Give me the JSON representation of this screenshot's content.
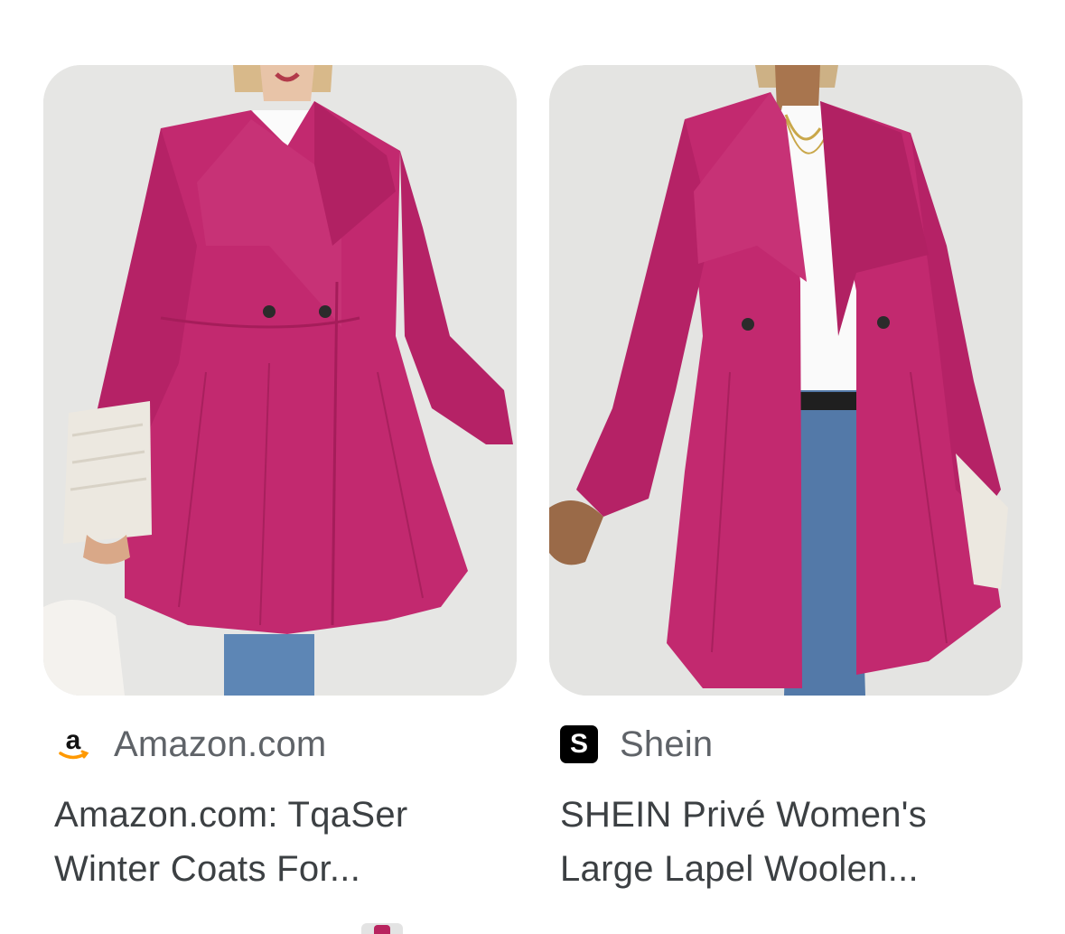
{
  "results": [
    {
      "source": "Amazon.com",
      "source_icon": "amazon-logo-icon",
      "title_line1": "Amazon.com: TqaSer",
      "title_line2": "Winter Coats For..."
    },
    {
      "source": "Shein",
      "source_icon": "shein-logo-icon",
      "favicon_letter": "S",
      "title_line1": "SHEIN Privé Women's",
      "title_line2": "Large Lapel Woolen..."
    }
  ],
  "colors": {
    "coat": "#c2296f",
    "background": "#e4e4e2",
    "source_text": "#5f6368",
    "title_text": "#3c4043",
    "amazon_orange": "#ff9900"
  }
}
